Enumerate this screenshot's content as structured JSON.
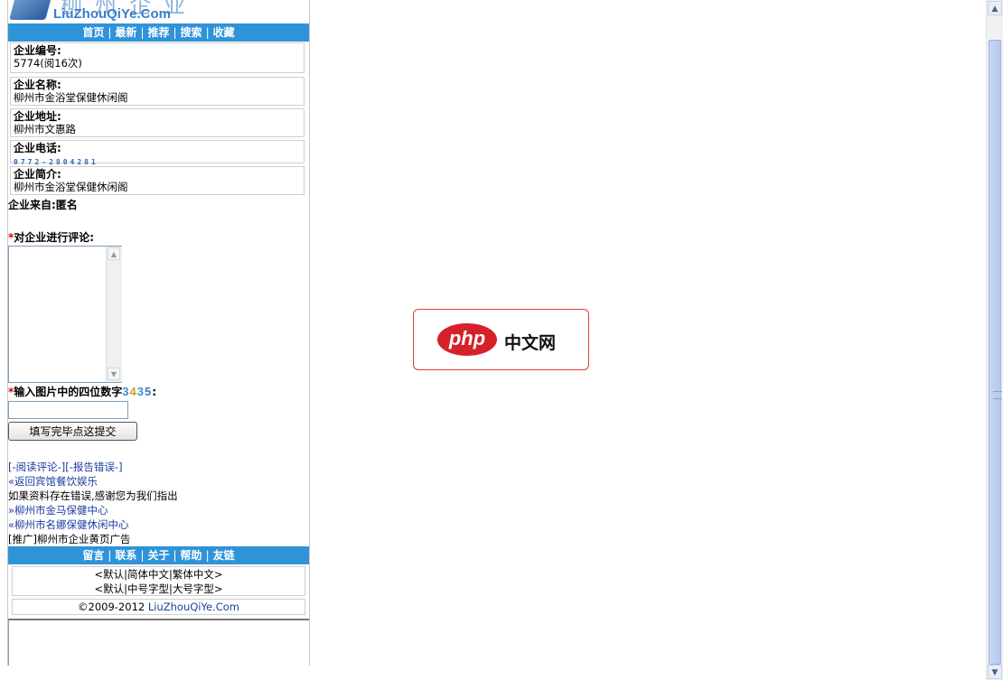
{
  "logo": {
    "chinese": "柳州企业",
    "english": "LiuZhouQiYe.Com"
  },
  "top_nav": [
    {
      "label": "首页"
    },
    {
      "label": "最新"
    },
    {
      "label": "推荐"
    },
    {
      "label": "搜索"
    },
    {
      "label": "收藏"
    }
  ],
  "nav_separator": "|",
  "company": {
    "id_label": "企业编号:",
    "id_value": "5774(阅16次)",
    "name_label": "企业名称:",
    "name_value": "柳州市金浴堂保健休闲阁",
    "address_label": "企业地址:",
    "address_value": "柳州市文惠路",
    "phone_label": "企业电话:",
    "phone_value": "0772-2804281",
    "intro_label": "企业简介:",
    "intro_value": "柳州市金浴堂保健休闲阁",
    "source": "企业来自:匿名"
  },
  "comment_form": {
    "required_mark": "*",
    "comment_label": "对企业进行评论:",
    "captcha_label": "输入图片中的四位数字",
    "captcha_digits": [
      "3",
      "4",
      "3",
      "5"
    ],
    "captcha_suffix": ":",
    "submit_label": "填写完毕点这提交"
  },
  "links": {
    "read_comments": "[-阅读评论-]",
    "report_error": "[-报告错误-]",
    "back_link": "«返回宾馆餐饮娱乐",
    "notice": "如果资料存在错误,感谢您为我们指出",
    "related_1": "»柳州市金马保健中心",
    "related_2": "«柳州市名娜保健休闲中心",
    "promo": "[推广]柳州市企业黄页广告"
  },
  "bottom_nav": [
    {
      "label": "留言"
    },
    {
      "label": "联系"
    },
    {
      "label": "关于"
    },
    {
      "label": "帮助"
    },
    {
      "label": "友链"
    }
  ],
  "lang_options": [
    "<默认|简体中文|繁体中文>"
  ],
  "size_options": [
    "<默认|中号字型|大号字型>"
  ],
  "copyright_prefix": "©2009-2012 ",
  "copyright_site": "LiuZhouQiYe.Com",
  "ad": {
    "brand": "php",
    "text": "中文网"
  },
  "colors": {
    "nav_bar": "#2f93d8",
    "link": "#1a3c9c",
    "ad_red": "#d6202a"
  },
  "scrollbar": {
    "up_icon": "arrow-up",
    "down_icon": "arrow-down"
  }
}
